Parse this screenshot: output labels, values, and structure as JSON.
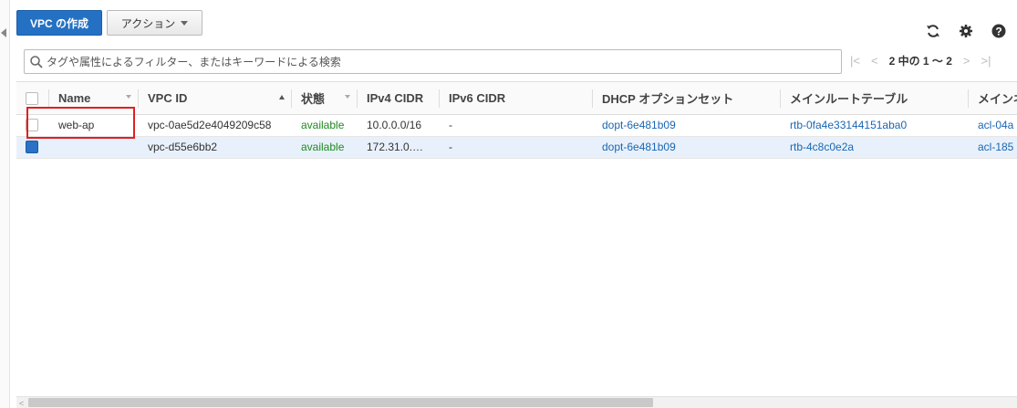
{
  "toolbar": {
    "create_vpc_label": "VPC の作成",
    "actions_label": "アクション"
  },
  "filter": {
    "placeholder": "タグや属性によるフィルター、またはキーワードによる検索"
  },
  "pager": {
    "text": "2 中の 1 ～ 2"
  },
  "icons": {
    "refresh": "refresh-icon",
    "settings": "gear-icon",
    "help": "help-icon",
    "search": "search-icon"
  },
  "table": {
    "headers": [
      "Name",
      "VPC ID",
      "状態",
      "IPv4 CIDR",
      "IPv6 CIDR",
      "DHCP オプションセット",
      "メインルートテーブル",
      "メインネ"
    ],
    "rows": [
      {
        "selected": false,
        "name": "web-ap",
        "vpc_id": "vpc-0ae5d2e4049209c58",
        "state": "available",
        "ipv4": "10.0.0.0/16",
        "ipv6": "-",
        "dhcp": "dopt-6e481b09",
        "route_table": "rtb-0fa4e33144151aba0",
        "acl": "acl-04a"
      },
      {
        "selected": true,
        "name": "",
        "vpc_id": "vpc-d55e6bb2",
        "state": "available",
        "ipv4": "172.31.0.…",
        "ipv6": "-",
        "dhcp": "dopt-6e481b09",
        "route_table": "rtb-4c8c0e2a",
        "acl": "acl-185"
      }
    ]
  },
  "colors": {
    "primary": "#2471c4",
    "status_ok": "#1e8a1e",
    "link": "#1a66b3",
    "highlight": "#e02020"
  }
}
